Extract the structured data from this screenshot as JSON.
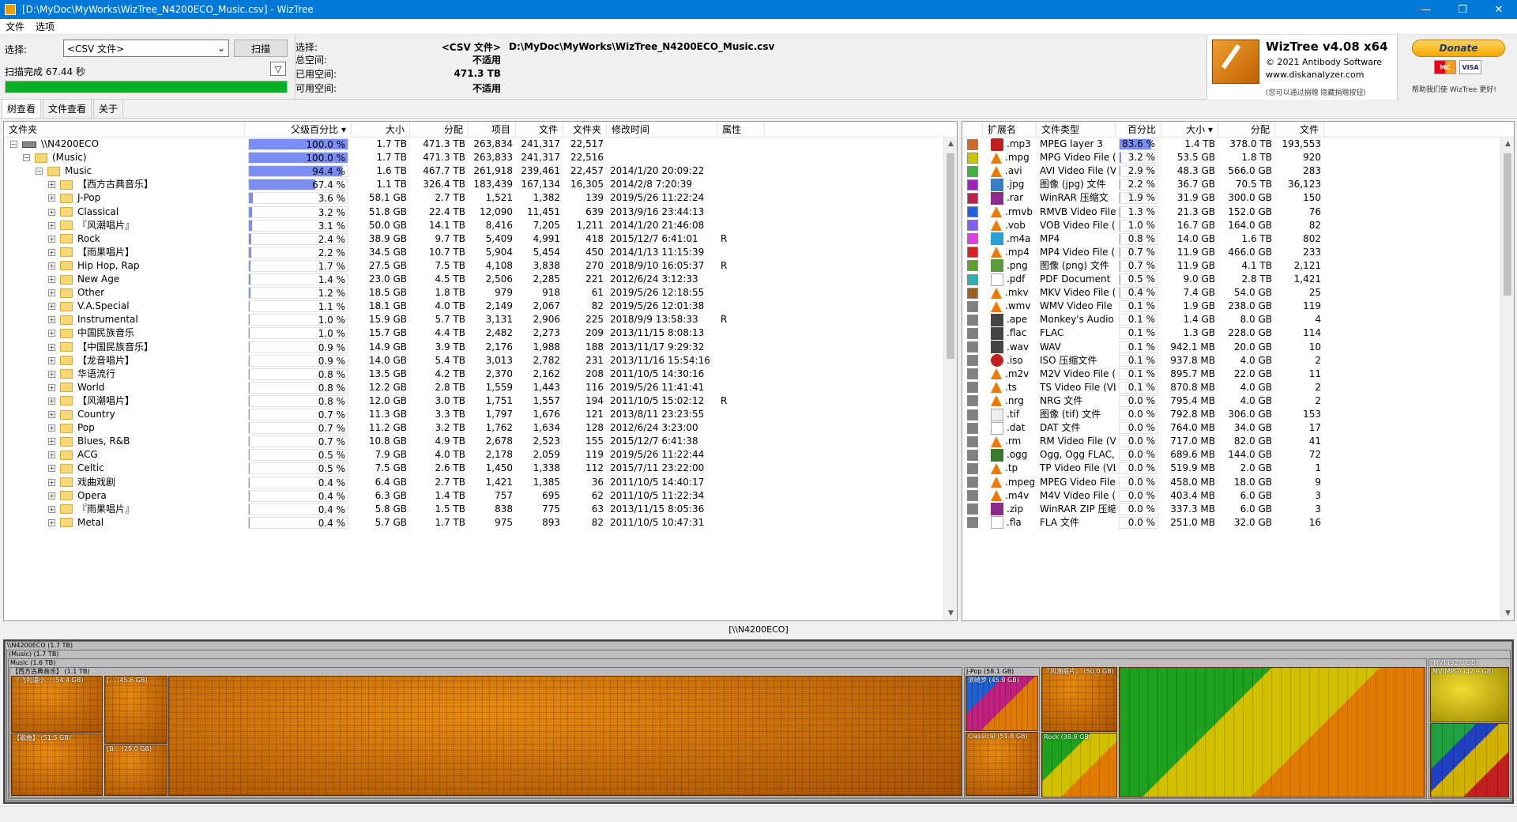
{
  "window": {
    "title": "[D:\\MyDoc\\MyWorks\\WizTree_N4200ECO_Music.csv]  - WizTree",
    "controls": [
      "—",
      "❐",
      "✕"
    ]
  },
  "menu": [
    "文件",
    "选项"
  ],
  "scan": {
    "select_label": "选择:",
    "select_value": "<CSV 文件>",
    "scan_button": "扫描",
    "status": "扫描完成 67.44 秒",
    "progress": 1.0
  },
  "info": {
    "select_k": "选择:",
    "select_v": "<CSV 文件>",
    "select_path": "D:\\MyDoc\\MyWorks\\WizTree_N4200ECO_Music.csv",
    "total_k": "总空间:",
    "total_v": "不适用",
    "used_k": "已用空间:",
    "used_v": "471.3 TB",
    "free_k": "可用空间:",
    "free_v": "不适用"
  },
  "brand": {
    "name": "WizTree v4.08 x64",
    "copyright": "© 2021 Antibody Software",
    "url": "www.diskanalyzer.com",
    "note": "(您可以通过捐赠 隐藏捐赠按钮)"
  },
  "donate": {
    "label": "Donate",
    "card1": "MC",
    "card2": "VISA",
    "note": "帮助我们使 WizTree 更好!"
  },
  "tabs": [
    "树查看",
    "文件查看",
    "关于"
  ],
  "folder_columns": [
    "文件夹",
    "父级百分比 ▾",
    "大小",
    "分配",
    "项目",
    "文件",
    "文件夹",
    "修改时间",
    "属性"
  ],
  "folders": [
    {
      "name": "\\\\N4200ECO",
      "level": 0,
      "kind": "drive",
      "pct": 100.0,
      "pct_label": "100.0 %",
      "size": "1.7 TB",
      "alloc": "471.3 TB",
      "items": "263,834",
      "files": "241,317",
      "dirs": "22,517",
      "mtime": "",
      "attr": ""
    },
    {
      "name": "(Music)",
      "level": 1,
      "kind": "folder",
      "pct": 100.0,
      "pct_label": "100.0 %",
      "size": "1.7 TB",
      "alloc": "471.3 TB",
      "items": "263,833",
      "files": "241,317",
      "dirs": "22,516",
      "mtime": "",
      "attr": ""
    },
    {
      "name": "Music",
      "level": 2,
      "kind": "folder",
      "pct": 94.4,
      "pct_label": "94.4 %",
      "size": "1.6 TB",
      "alloc": "467.7 TB",
      "items": "261,918",
      "files": "239,461",
      "dirs": "22,457",
      "mtime": "2014/1/20 20:09:22",
      "attr": ""
    },
    {
      "name": "【西方古典音乐】",
      "level": 3,
      "kind": "folder",
      "pct": 67.4,
      "pct_label": "67.4 %",
      "size": "1.1 TB",
      "alloc": "326.4 TB",
      "items": "183,439",
      "files": "167,134",
      "dirs": "16,305",
      "mtime": "2014/2/8 7:20:39",
      "attr": ""
    },
    {
      "name": "J-Pop",
      "level": 3,
      "kind": "folder",
      "pct": 3.6,
      "pct_label": "3.6 %",
      "size": "58.1 GB",
      "alloc": "2.7 TB",
      "items": "1,521",
      "files": "1,382",
      "dirs": "139",
      "mtime": "2019/5/26 11:22:24",
      "attr": ""
    },
    {
      "name": "Classical",
      "level": 3,
      "kind": "folder",
      "pct": 3.2,
      "pct_label": "3.2 %",
      "size": "51.8 GB",
      "alloc": "22.4 TB",
      "items": "12,090",
      "files": "11,451",
      "dirs": "639",
      "mtime": "2013/9/16 23:44:13",
      "attr": ""
    },
    {
      "name": "『风潮唱片』",
      "level": 3,
      "kind": "folder",
      "pct": 3.1,
      "pct_label": "3.1 %",
      "size": "50.0 GB",
      "alloc": "14.1 TB",
      "items": "8,416",
      "files": "7,205",
      "dirs": "1,211",
      "mtime": "2014/1/20 21:46:08",
      "attr": ""
    },
    {
      "name": "Rock",
      "level": 3,
      "kind": "folder",
      "pct": 2.4,
      "pct_label": "2.4 %",
      "size": "38.9 GB",
      "alloc": "9.7 TB",
      "items": "5,409",
      "files": "4,991",
      "dirs": "418",
      "mtime": "2015/12/7 6:41:01",
      "attr": "R"
    },
    {
      "name": "【雨果唱片】",
      "level": 3,
      "kind": "folder",
      "pct": 2.2,
      "pct_label": "2.2 %",
      "size": "34.5 GB",
      "alloc": "10.7 TB",
      "items": "5,904",
      "files": "5,454",
      "dirs": "450",
      "mtime": "2014/1/13 11:15:39",
      "attr": ""
    },
    {
      "name": "Hip Hop, Rap",
      "level": 3,
      "kind": "folder",
      "pct": 1.7,
      "pct_label": "1.7 %",
      "size": "27.5 GB",
      "alloc": "7.5 TB",
      "items": "4,108",
      "files": "3,838",
      "dirs": "270",
      "mtime": "2018/9/10 16:05:37",
      "attr": "R"
    },
    {
      "name": "New Age",
      "level": 3,
      "kind": "folder",
      "pct": 1.4,
      "pct_label": "1.4 %",
      "size": "23.0 GB",
      "alloc": "4.5 TB",
      "items": "2,506",
      "files": "2,285",
      "dirs": "221",
      "mtime": "2012/6/24 3:12:33",
      "attr": ""
    },
    {
      "name": "Other",
      "level": 3,
      "kind": "folder",
      "pct": 1.2,
      "pct_label": "1.2 %",
      "size": "18.5 GB",
      "alloc": "1.8 TB",
      "items": "979",
      "files": "918",
      "dirs": "61",
      "mtime": "2019/5/26 12:18:55",
      "attr": ""
    },
    {
      "name": "V.A.Special",
      "level": 3,
      "kind": "folder",
      "pct": 1.1,
      "pct_label": "1.1 %",
      "size": "18.1 GB",
      "alloc": "4.0 TB",
      "items": "2,149",
      "files": "2,067",
      "dirs": "82",
      "mtime": "2019/5/26 12:01:38",
      "attr": ""
    },
    {
      "name": "Instrumental",
      "level": 3,
      "kind": "folder",
      "pct": 1.0,
      "pct_label": "1.0 %",
      "size": "15.9 GB",
      "alloc": "5.7 TB",
      "items": "3,131",
      "files": "2,906",
      "dirs": "225",
      "mtime": "2018/9/9 13:58:33",
      "attr": "R"
    },
    {
      "name": "中国民族音乐",
      "level": 3,
      "kind": "folder",
      "pct": 1.0,
      "pct_label": "1.0 %",
      "size": "15.7 GB",
      "alloc": "4.4 TB",
      "items": "2,482",
      "files": "2,273",
      "dirs": "209",
      "mtime": "2013/11/15 8:08:13",
      "attr": ""
    },
    {
      "name": "【中国民族音乐】",
      "level": 3,
      "kind": "folder",
      "pct": 0.9,
      "pct_label": "0.9 %",
      "size": "14.9 GB",
      "alloc": "3.9 TB",
      "items": "2,176",
      "files": "1,988",
      "dirs": "188",
      "mtime": "2013/11/17 9:29:32",
      "attr": ""
    },
    {
      "name": "【龙音唱片】",
      "level": 3,
      "kind": "folder",
      "pct": 0.9,
      "pct_label": "0.9 %",
      "size": "14.0 GB",
      "alloc": "5.4 TB",
      "items": "3,013",
      "files": "2,782",
      "dirs": "231",
      "mtime": "2013/11/16 15:54:16",
      "attr": ""
    },
    {
      "name": "华语流行",
      "level": 3,
      "kind": "folder",
      "pct": 0.8,
      "pct_label": "0.8 %",
      "size": "13.5 GB",
      "alloc": "4.2 TB",
      "items": "2,370",
      "files": "2,162",
      "dirs": "208",
      "mtime": "2011/10/5 14:30:16",
      "attr": ""
    },
    {
      "name": "World",
      "level": 3,
      "kind": "folder",
      "pct": 0.8,
      "pct_label": "0.8 %",
      "size": "12.2 GB",
      "alloc": "2.8 TB",
      "items": "1,559",
      "files": "1,443",
      "dirs": "116",
      "mtime": "2019/5/26 11:41:41",
      "attr": ""
    },
    {
      "name": "【风潮唱片】",
      "level": 3,
      "kind": "folder",
      "pct": 0.8,
      "pct_label": "0.8 %",
      "size": "12.0 GB",
      "alloc": "3.0 TB",
      "items": "1,751",
      "files": "1,557",
      "dirs": "194",
      "mtime": "2011/10/5 15:02:12",
      "attr": "R"
    },
    {
      "name": "Country",
      "level": 3,
      "kind": "folder",
      "pct": 0.7,
      "pct_label": "0.7 %",
      "size": "11.3 GB",
      "alloc": "3.3 TB",
      "items": "1,797",
      "files": "1,676",
      "dirs": "121",
      "mtime": "2013/8/11 23:23:55",
      "attr": ""
    },
    {
      "name": "Pop",
      "level": 3,
      "kind": "folder",
      "pct": 0.7,
      "pct_label": "0.7 %",
      "size": "11.2 GB",
      "alloc": "3.2 TB",
      "items": "1,762",
      "files": "1,634",
      "dirs": "128",
      "mtime": "2012/6/24 3:23:00",
      "attr": ""
    },
    {
      "name": "Blues, R&B",
      "level": 3,
      "kind": "folder",
      "pct": 0.7,
      "pct_label": "0.7 %",
      "size": "10.8 GB",
      "alloc": "4.9 TB",
      "items": "2,678",
      "files": "2,523",
      "dirs": "155",
      "mtime": "2015/12/7 6:41:38",
      "attr": ""
    },
    {
      "name": "ACG",
      "level": 3,
      "kind": "folder",
      "pct": 0.5,
      "pct_label": "0.5 %",
      "size": "7.9 GB",
      "alloc": "4.0 TB",
      "items": "2,178",
      "files": "2,059",
      "dirs": "119",
      "mtime": "2019/5/26 11:22:44",
      "attr": ""
    },
    {
      "name": "Celtic",
      "level": 3,
      "kind": "folder",
      "pct": 0.5,
      "pct_label": "0.5 %",
      "size": "7.5 GB",
      "alloc": "2.6 TB",
      "items": "1,450",
      "files": "1,338",
      "dirs": "112",
      "mtime": "2015/7/11 23:22:00",
      "attr": ""
    },
    {
      "name": "戏曲戏剧",
      "level": 3,
      "kind": "folder",
      "pct": 0.4,
      "pct_label": "0.4 %",
      "size": "6.4 GB",
      "alloc": "2.7 TB",
      "items": "1,421",
      "files": "1,385",
      "dirs": "36",
      "mtime": "2011/10/5 14:40:17",
      "attr": ""
    },
    {
      "name": "Opera",
      "level": 3,
      "kind": "folder",
      "pct": 0.4,
      "pct_label": "0.4 %",
      "size": "6.3 GB",
      "alloc": "1.4 TB",
      "items": "757",
      "files": "695",
      "dirs": "62",
      "mtime": "2011/10/5 11:22:34",
      "attr": ""
    },
    {
      "name": "『雨果唱片』",
      "level": 3,
      "kind": "folder",
      "pct": 0.4,
      "pct_label": "0.4 %",
      "size": "5.8 GB",
      "alloc": "1.5 TB",
      "items": "838",
      "files": "775",
      "dirs": "63",
      "mtime": "2013/11/15 8:05:36",
      "attr": ""
    },
    {
      "name": "Metal",
      "level": 3,
      "kind": "folder",
      "pct": 0.4,
      "pct_label": "0.4 %",
      "size": "5.7 GB",
      "alloc": "1.7 TB",
      "items": "975",
      "files": "893",
      "dirs": "82",
      "mtime": "2011/10/5 10:47:31",
      "attr": ""
    }
  ],
  "ext_columns": [
    "扩展名",
    "文件类型",
    "百分比",
    "大小 ▾",
    "分配",
    "文件"
  ],
  "extensions": [
    {
      "color": "#d2691e",
      "icon": "mp3",
      "ext": ".mp3",
      "type": "MPEG layer 3",
      "pct": 83.6,
      "pct_label": "83.6 %",
      "size": "1.4 TB",
      "alloc": "378.0 TB",
      "files": "193,553"
    },
    {
      "color": "#c8c800",
      "icon": "cone",
      "ext": ".mpg",
      "type": "MPG Video File (",
      "pct": 3.2,
      "pct_label": "3.2 %",
      "size": "53.5 GB",
      "alloc": "1.8 TB",
      "files": "920"
    },
    {
      "color": "#40b040",
      "icon": "cone",
      "ext": ".avi",
      "type": "AVI Video File (V",
      "pct": 2.9,
      "pct_label": "2.9 %",
      "size": "48.3 GB",
      "alloc": "566.0 GB",
      "files": "283"
    },
    {
      "color": "#a020c0",
      "icon": "jpg",
      "ext": ".jpg",
      "type": "图像 (jpg) 文件",
      "pct": 2.2,
      "pct_label": "2.2 %",
      "size": "36.7 GB",
      "alloc": "70.5 TB",
      "files": "36,123"
    },
    {
      "color": "#c02050",
      "icon": "rar",
      "ext": ".rar",
      "type": "WinRAR 压缩文",
      "pct": 1.9,
      "pct_label": "1.9 %",
      "size": "31.9 GB",
      "alloc": "300.0 GB",
      "files": "150"
    },
    {
      "color": "#2060e0",
      "icon": "cone",
      "ext": ".rmvb",
      "type": "RMVB Video File",
      "pct": 1.3,
      "pct_label": "1.3 %",
      "size": "21.3 GB",
      "alloc": "152.0 GB",
      "files": "76"
    },
    {
      "color": "#8060f0",
      "icon": "cone",
      "ext": ".vob",
      "type": "VOB Video File (V",
      "pct": 1.0,
      "pct_label": "1.0 %",
      "size": "16.7 GB",
      "alloc": "164.0 GB",
      "files": "82"
    },
    {
      "color": "#e040e0",
      "icon": "m4a",
      "ext": ".m4a",
      "type": "MP4",
      "pct": 0.8,
      "pct_label": "0.8 %",
      "size": "14.0 GB",
      "alloc": "1.6 TB",
      "files": "802"
    },
    {
      "color": "#e02020",
      "icon": "cone",
      "ext": ".mp4",
      "type": "MP4 Video File (",
      "pct": 0.7,
      "pct_label": "0.7 %",
      "size": "11.9 GB",
      "alloc": "466.0 GB",
      "files": "233"
    },
    {
      "color": "#60a030",
      "icon": "png",
      "ext": ".png",
      "type": "图像 (png) 文件",
      "pct": 0.7,
      "pct_label": "0.7 %",
      "size": "11.9 GB",
      "alloc": "4.1 TB",
      "files": "2,121"
    },
    {
      "color": "#30b0b0",
      "icon": "pdf",
      "ext": ".pdf",
      "type": "PDF Document",
      "pct": 0.5,
      "pct_label": "0.5 %",
      "size": "9.0 GB",
      "alloc": "2.8 TB",
      "files": "1,421"
    },
    {
      "color": "#a06020",
      "icon": "cone",
      "ext": ".mkv",
      "type": "MKV Video File (",
      "pct": 0.4,
      "pct_label": "0.4 %",
      "size": "7.4 GB",
      "alloc": "54.0 GB",
      "files": "25"
    },
    {
      "color": "#808080",
      "icon": "cone",
      "ext": ".wmv",
      "type": "WMV Video File",
      "pct": 0.1,
      "pct_label": "0.1 %",
      "size": "1.9 GB",
      "alloc": "238.0 GB",
      "files": "119"
    },
    {
      "color": "#808080",
      "icon": "ape",
      "ext": ".ape",
      "type": "Monkey's Audio",
      "pct": 0.1,
      "pct_label": "0.1 %",
      "size": "1.4 GB",
      "alloc": "8.0 GB",
      "files": "4"
    },
    {
      "color": "#808080",
      "icon": "ape",
      "ext": ".flac",
      "type": "FLAC",
      "pct": 0.1,
      "pct_label": "0.1 %",
      "size": "1.3 GB",
      "alloc": "228.0 GB",
      "files": "114"
    },
    {
      "color": "#808080",
      "icon": "ape",
      "ext": ".wav",
      "type": "WAV",
      "pct": 0.1,
      "pct_label": "0.1 %",
      "size": "942.1 MB",
      "alloc": "20.0 GB",
      "files": "10"
    },
    {
      "color": "#808080",
      "icon": "iso",
      "ext": ".iso",
      "type": "ISO 压缩文件",
      "pct": 0.1,
      "pct_label": "0.1 %",
      "size": "937.8 MB",
      "alloc": "4.0 GB",
      "files": "2"
    },
    {
      "color": "#808080",
      "icon": "cone",
      "ext": ".m2v",
      "type": "M2V Video File (",
      "pct": 0.1,
      "pct_label": "0.1 %",
      "size": "895.7 MB",
      "alloc": "22.0 GB",
      "files": "11"
    },
    {
      "color": "#808080",
      "icon": "cone",
      "ext": ".ts",
      "type": "TS Video File (VL",
      "pct": 0.1,
      "pct_label": "0.1 %",
      "size": "870.8 MB",
      "alloc": "4.0 GB",
      "files": "2"
    },
    {
      "color": "#808080",
      "icon": "cone",
      "ext": ".nrg",
      "type": "NRG 文件",
      "pct": 0.0,
      "pct_label": "0.0 %",
      "size": "795.4 MB",
      "alloc": "4.0 GB",
      "files": "2"
    },
    {
      "color": "#808080",
      "icon": "tif",
      "ext": ".tif",
      "type": "图像 (tif) 文件",
      "pct": 0.0,
      "pct_label": "0.0 %",
      "size": "792.8 MB",
      "alloc": "306.0 GB",
      "files": "153"
    },
    {
      "color": "#808080",
      "icon": "doc",
      "ext": ".dat",
      "type": "DAT 文件",
      "pct": 0.0,
      "pct_label": "0.0 %",
      "size": "764.0 MB",
      "alloc": "34.0 GB",
      "files": "17"
    },
    {
      "color": "#808080",
      "icon": "cone",
      "ext": ".rm",
      "type": "RM Video File (V",
      "pct": 0.0,
      "pct_label": "0.0 %",
      "size": "717.0 MB",
      "alloc": "82.0 GB",
      "files": "41"
    },
    {
      "color": "#808080",
      "icon": "ogg",
      "ext": ".ogg",
      "type": "Ogg, Ogg FLAC,",
      "pct": 0.0,
      "pct_label": "0.0 %",
      "size": "689.6 MB",
      "alloc": "144.0 GB",
      "files": "72"
    },
    {
      "color": "#808080",
      "icon": "cone",
      "ext": ".tp",
      "type": "TP Video File (VL",
      "pct": 0.0,
      "pct_label": "0.0 %",
      "size": "519.9 MB",
      "alloc": "2.0 GB",
      "files": "1"
    },
    {
      "color": "#808080",
      "icon": "cone",
      "ext": ".mpeg",
      "type": "MPEG Video File",
      "pct": 0.0,
      "pct_label": "0.0 %",
      "size": "458.0 MB",
      "alloc": "18.0 GB",
      "files": "9"
    },
    {
      "color": "#808080",
      "icon": "cone",
      "ext": ".m4v",
      "type": "M4V Video File (",
      "pct": 0.0,
      "pct_label": "0.0 %",
      "size": "403.4 MB",
      "alloc": "6.0 GB",
      "files": "3"
    },
    {
      "color": "#808080",
      "icon": "zip",
      "ext": ".zip",
      "type": "WinRAR ZIP 压缩",
      "pct": 0.0,
      "pct_label": "0.0 %",
      "size": "337.3 MB",
      "alloc": "6.0 GB",
      "files": "3"
    },
    {
      "color": "#808080",
      "icon": "doc",
      "ext": ".fla",
      "type": "FLA 文件",
      "pct": 0.0,
      "pct_label": "0.0 %",
      "size": "251.0 MB",
      "alloc": "32.0 GB",
      "files": "16"
    }
  ],
  "treemap": {
    "path_label": "[\\\\N4200ECO]",
    "labels": {
      "root": "\\\\N4200ECO (1.7 TB)",
      "music_paren": "(Music) (1.7 TB)",
      "music": "Music (1.6 TB)",
      "classic": "【西方古典音乐】 (1.1 TB)",
      "sub1": "『飞利浦小... (54.4 GB)",
      "sub2": "[... (45.6 GB)",
      "sub3": "【歌曲】 (51.5 GB)",
      "sub4": "[B... (29.0 GB)",
      "jpop": "J-Pop (58.1 GB)",
      "jpop_sub": "滨崎步 (45.9 GB)",
      "classical": "Classical (51.8 GB)",
      "fengchao": "『风潮唱片』 (50.0 GB)",
      "rock": "Rock (38.9 GB)",
      "mv": "[MV] (92.0 GB)",
      "mvmpg": "MV(MPG) (42.9 GB)"
    }
  }
}
